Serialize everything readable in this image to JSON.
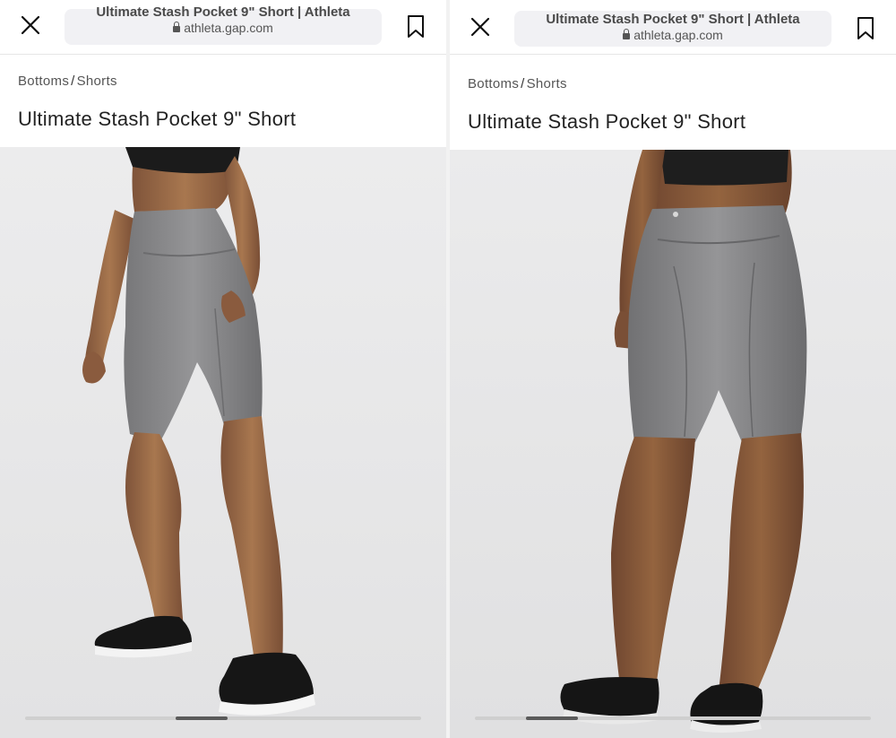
{
  "panels": [
    {
      "url_title": "Ultimate Stash Pocket 9\" Short | Athleta",
      "domain": "athleta.gap.com",
      "breadcrumb": {
        "category": "Bottoms",
        "separator": "/",
        "subcategory": "Shorts"
      },
      "product_title": "Ultimate Stash Pocket 9\" Short",
      "image_label": "Side view of model wearing heather grey shorts",
      "carousel_progress": 0.38
    },
    {
      "url_title": "Ultimate Stash Pocket 9\" Short | Athleta",
      "domain": "athleta.gap.com",
      "breadcrumb": {
        "category": "Bottoms",
        "separator": "/",
        "subcategory": "Shorts"
      },
      "product_title": "Ultimate Stash Pocket 9\" Short",
      "image_label": "Back view of model wearing heather grey shorts",
      "carousel_progress": 0.13
    }
  ],
  "colors": {
    "shorts": "#8a8a8c",
    "skin": "#9a6a4a",
    "photo_bg": "#e9e9ea",
    "shoe": "#1a1a1a",
    "scroll_thumb": "#5a5a5a"
  },
  "icons": {
    "close": "close-icon",
    "bookmark": "bookmark-icon",
    "lock": "lock-icon"
  }
}
